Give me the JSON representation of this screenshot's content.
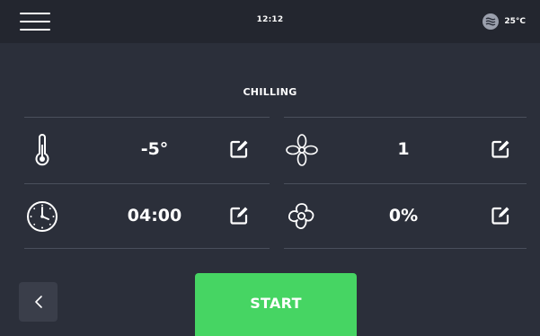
{
  "status_bar": {
    "menu_icon": "hamburger-icon",
    "time": "12:12",
    "ambient_icon": "waves-icon",
    "ambient_temperature": "25°C"
  },
  "mode": {
    "title": "CHILLING"
  },
  "parameters": [
    {
      "id": "temperature",
      "icon": "thermometer-icon",
      "value": "-5°",
      "edit_icon": "edit-icon"
    },
    {
      "id": "fan-speed",
      "icon": "fan-icon",
      "value": "1",
      "edit_icon": "edit-icon"
    },
    {
      "id": "time",
      "icon": "clock-icon",
      "value": "04:00",
      "edit_icon": "edit-icon"
    },
    {
      "id": "humidity",
      "icon": "flower-icon",
      "value": "0%",
      "edit_icon": "edit-icon"
    }
  ],
  "actions": {
    "back_icon": "chevron-left-icon",
    "start_label": "START"
  },
  "colors": {
    "background": "#2b2f3a",
    "status_bar": "#23262f",
    "divider": "#4a4f5c",
    "start_button": "#46d563",
    "back_button": "#3a3e4a"
  }
}
